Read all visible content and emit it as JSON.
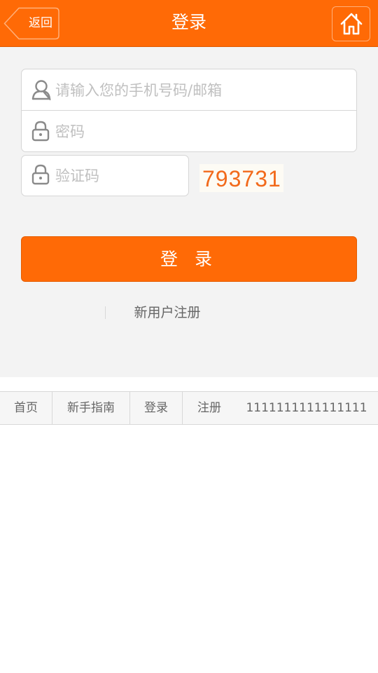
{
  "header": {
    "back_label": "返回",
    "title": "登录",
    "background_color": "#ff6a06"
  },
  "login_form": {
    "account_placeholder": "请输入您的手机号码/邮箱",
    "account_value": "",
    "password_placeholder": "密码",
    "password_value": "",
    "captcha_placeholder": "验证码",
    "captcha_value": "",
    "captcha_code": "793731",
    "submit_label": "登 录",
    "register_link": "新用户注册"
  },
  "footer_nav": {
    "items": [
      {
        "label": "首页"
      },
      {
        "label": "新手指南"
      },
      {
        "label": "登录"
      },
      {
        "label": "注册"
      },
      {
        "label": "1111111111111111"
      }
    ]
  },
  "icons": {
    "back": "chevron-left-icon",
    "home": "home-icon",
    "user": "user-icon",
    "lock": "lock-icon"
  }
}
